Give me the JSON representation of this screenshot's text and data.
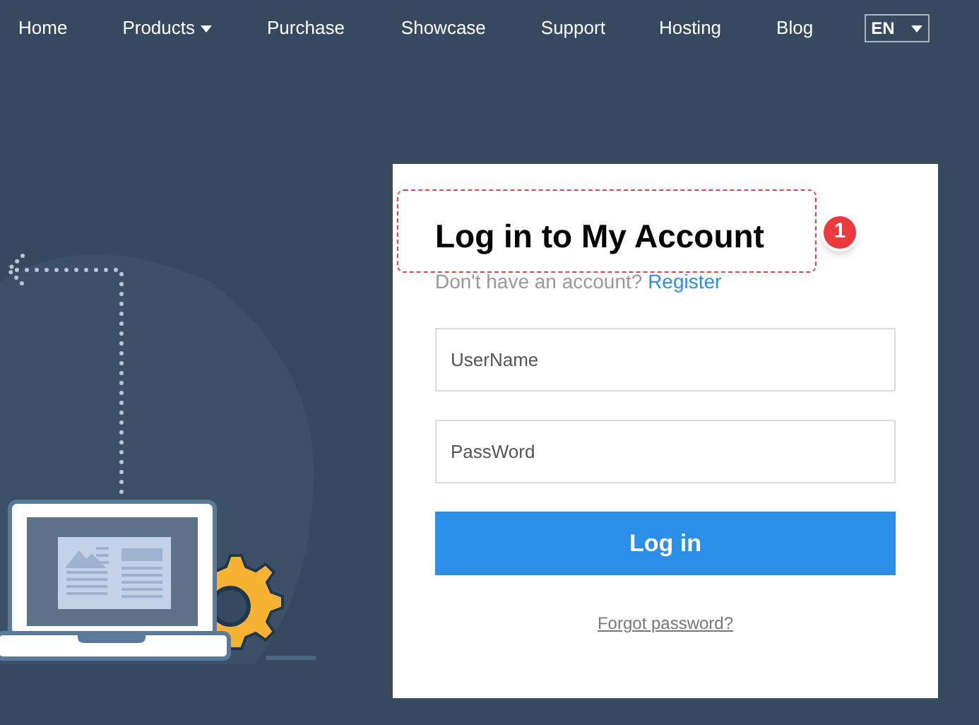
{
  "nav": {
    "items": [
      {
        "label": "Home",
        "dropdown": false
      },
      {
        "label": "Products",
        "dropdown": true
      },
      {
        "label": "Purchase",
        "dropdown": false
      },
      {
        "label": "Showcase",
        "dropdown": false
      },
      {
        "label": "Support",
        "dropdown": false
      },
      {
        "label": "Hosting",
        "dropdown": false
      },
      {
        "label": "Blog",
        "dropdown": false
      }
    ],
    "language": "EN"
  },
  "login": {
    "title": "Log in to My Account",
    "prompt": "Don't have an account?",
    "register_link": "Register",
    "fields": [
      {
        "placeholder": "UserName"
      },
      {
        "placeholder": "PassWord"
      }
    ],
    "button": "Log in",
    "forgot_link": "Forgot password?"
  },
  "annotation": {
    "number": "1"
  }
}
